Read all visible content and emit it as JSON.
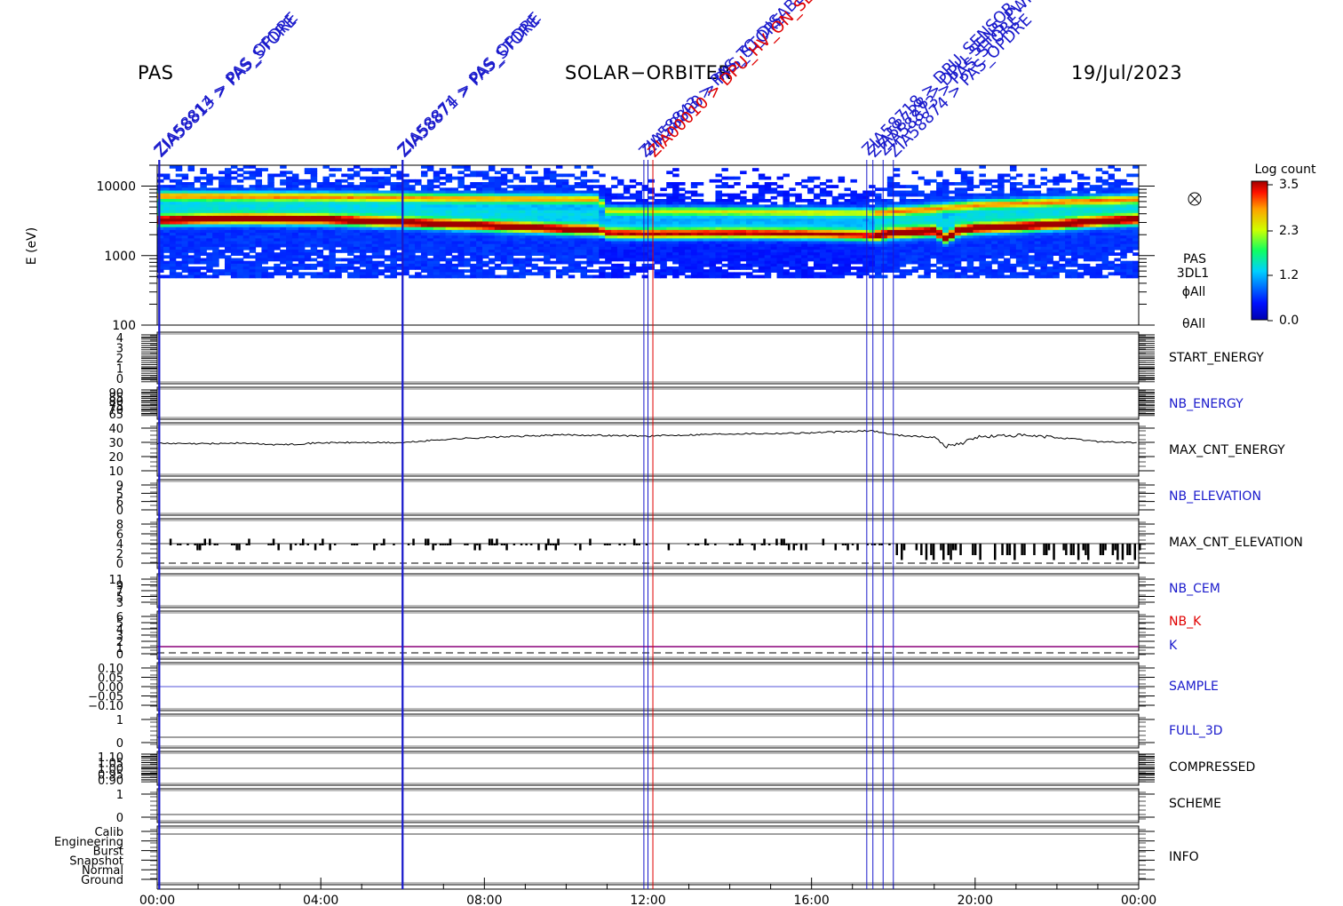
{
  "header": {
    "instrument": "PAS",
    "mission": "SOLAR−ORBITER",
    "date": "19/Jul/2023"
  },
  "colors": {
    "blue": "#1a1acc",
    "red": "#e00000",
    "purple": "#8a007a",
    "black": "#000000"
  },
  "events": [
    {
      "time_h": 0.05,
      "label": "ZIA58813 > PAS_STORE",
      "color": "#1a1acc"
    },
    {
      "time_h": 0.05,
      "label": "ZIA58814 > PAS_OPDRE",
      "color": "#1a1acc"
    },
    {
      "time_h": 6.0,
      "label": "ZIA58871 > PAS_STORE",
      "color": "#1a1acc"
    },
    {
      "time_h": 6.0,
      "label": "ZIA58874 > PAS_OPDRE",
      "color": "#1a1acc"
    },
    {
      "time_h": 11.9,
      "label": "ZIA58843 > PAS_TC_DISABLE",
      "color": "#1a1acc"
    },
    {
      "time_h": 12.0,
      "label": "ZIA58800 > PAS_STORE",
      "color": "#1a1acc"
    },
    {
      "time_h": 12.12,
      "label": "ZIA00010 > DPU_HV_ON_SEM_NOT",
      "color": "#e00000"
    },
    {
      "time_h": 17.35,
      "label": "ZIA58718 > DPU_SENSOR_HV",
      "color": "#1a1acc"
    },
    {
      "time_h": 17.5,
      "label": "ZIA58728 > DPU_SENS_PWR",
      "color": "#1a1acc"
    },
    {
      "time_h": 17.75,
      "label": "ZIA58873 > PAS_STORE",
      "color": "#1a1acc"
    },
    {
      "time_h": 18.0,
      "label": "ZIA58874 > PAS_OPDRE",
      "color": "#1a1acc"
    }
  ],
  "chart_data": {
    "type": "heatmap",
    "x_ticks": [
      "00:00",
      "04:00",
      "08:00",
      "12:00",
      "16:00",
      "20:00",
      "00:00"
    ],
    "x_range_h": [
      0,
      24
    ],
    "spectrogram": {
      "ylabel": "E (eV)",
      "y_scale": "log",
      "ylim": [
        100,
        20000
      ],
      "y_ticks": [
        "10000",
        "1000",
        "100"
      ],
      "data_floor_ev": 480,
      "colorbar": {
        "title": "Log count",
        "range": [
          0.0,
          3.5
        ],
        "ticks": [
          "3.5",
          "2.3",
          "1.2",
          "0.0"
        ]
      },
      "right_labels": [
        "PAS",
        "3DL1",
        "ϕAll",
        "θAll"
      ],
      "peak_energy_ev": [
        [
          0,
          3200
        ],
        [
          2,
          3400
        ],
        [
          4,
          3300
        ],
        [
          6,
          3000
        ],
        [
          8,
          2700
        ],
        [
          10,
          2400
        ],
        [
          10.8,
          2350
        ],
        [
          11,
          2100
        ],
        [
          12,
          2050
        ],
        [
          14,
          2100
        ],
        [
          16,
          2050
        ],
        [
          17.3,
          1950
        ],
        [
          17.5,
          1900
        ],
        [
          18,
          2100
        ],
        [
          19,
          2250
        ],
        [
          19.3,
          1750
        ],
        [
          19.6,
          2300
        ],
        [
          20,
          2450
        ],
        [
          21,
          2600
        ],
        [
          22,
          2800
        ],
        [
          23,
          3100
        ],
        [
          24,
          3300
        ]
      ],
      "upper_band_energy_ev": [
        [
          0,
          7200
        ],
        [
          4,
          7000
        ],
        [
          8,
          6600
        ],
        [
          10.8,
          6400
        ],
        [
          11,
          4400
        ],
        [
          14,
          4300
        ],
        [
          17.5,
          4100
        ],
        [
          18,
          4300
        ],
        [
          19,
          4700
        ],
        [
          20,
          5300
        ],
        [
          22,
          5900
        ],
        [
          24,
          6500
        ]
      ]
    },
    "panels": [
      {
        "name": "START_ENERGY",
        "label_color": "#000000",
        "ticks": [
          "4",
          "3",
          "2",
          "1",
          "0"
        ]
      },
      {
        "name": "NB_ENERGY",
        "label_color": "#1a1acc",
        "ticks": [
          "90",
          "85",
          "80",
          "75",
          "70",
          "65"
        ]
      },
      {
        "name": "MAX_CNT_ENERGY",
        "label_color": "#000000",
        "ticks": [
          "40",
          "30",
          "20",
          "10"
        ],
        "series": [
          [
            0,
            29.5
          ],
          [
            1,
            29.2
          ],
          [
            2,
            29.8
          ],
          [
            3,
            28.5
          ],
          [
            4,
            30
          ],
          [
            5,
            30.2
          ],
          [
            6,
            30
          ],
          [
            7,
            32.5
          ],
          [
            8,
            34
          ],
          [
            9,
            35
          ],
          [
            10,
            36
          ],
          [
            11,
            35.5
          ],
          [
            12,
            35
          ],
          [
            13,
            36
          ],
          [
            14,
            36.8
          ],
          [
            15,
            37
          ],
          [
            16,
            37.5
          ],
          [
            17,
            38.5
          ],
          [
            17.5,
            39
          ],
          [
            18,
            36
          ],
          [
            19,
            34
          ],
          [
            19.3,
            27.5
          ],
          [
            19.7,
            30
          ],
          [
            20,
            34
          ],
          [
            20.5,
            35
          ],
          [
            21,
            35.5
          ],
          [
            22,
            34
          ],
          [
            23,
            31
          ],
          [
            24,
            30
          ]
        ]
      },
      {
        "name": "NB_ELEVATION",
        "label_color": "#1a1acc",
        "ticks": [
          "9",
          "5",
          "6",
          "0"
        ]
      },
      {
        "name": "MAX_CNT_ELEVATION",
        "label_color": "#000000",
        "ticks": [
          "8",
          "6",
          "4",
          "2",
          "0"
        ]
      },
      {
        "name": "NB_CEM",
        "label_color": "#1a1acc",
        "ticks": [
          "11",
          "9",
          "7",
          "5",
          "3"
        ]
      },
      {
        "name": "NB_K",
        "label_color": "#e00000",
        "ticks": [
          "6",
          "5",
          "4",
          "3",
          "2",
          "1",
          "0"
        ],
        "second_label": "K",
        "second_color": "#1a1acc"
      },
      {
        "name": "SAMPLE",
        "label_color": "#1a1acc",
        "ticks": [
          "0.10",
          "0.05",
          "0.00",
          "−0.05",
          "−0.10"
        ]
      },
      {
        "name": "FULL_3D",
        "label_color": "#1a1acc",
        "ticks": [
          "1",
          "0"
        ]
      },
      {
        "name": "COMPRESSED",
        "label_color": "#000000",
        "ticks": [
          "1.10",
          "1.05",
          "1.00",
          "0.95",
          "0.90"
        ]
      },
      {
        "name": "SCHEME",
        "label_color": "#000000",
        "ticks": [
          "1",
          "0"
        ]
      },
      {
        "name": "INFO",
        "label_color": "#000000",
        "ticks": [
          "Calib",
          "Engineering",
          "Burst",
          "Snapshot",
          "Normal",
          "Ground"
        ]
      }
    ]
  }
}
